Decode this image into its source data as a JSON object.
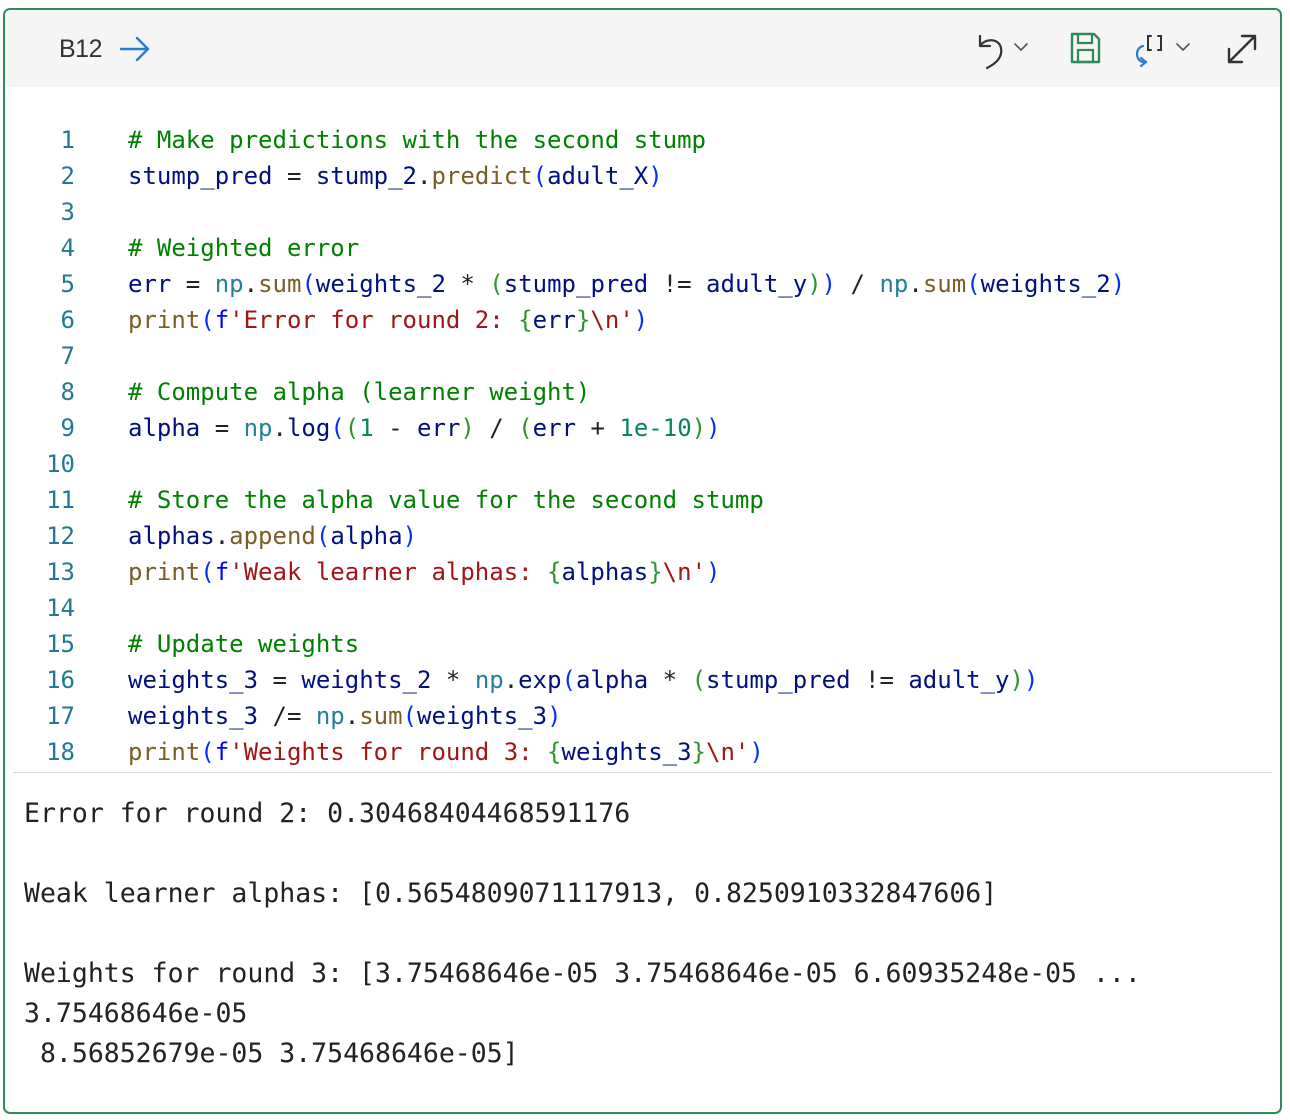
{
  "toolbar": {
    "cell_reference": "B12",
    "icons": [
      "arrow-right-icon",
      "undo-icon",
      "chevron-down-icon",
      "save-icon",
      "python-output-icon",
      "chevron-down-icon",
      "expand-icon"
    ]
  },
  "colors": {
    "border": "#2e8a5a",
    "comment": "#008000",
    "function": "#795e26",
    "string": "#a31515",
    "variable": "#001080",
    "number": "#098658",
    "line_number": "#237893"
  },
  "code_lines": [
    {
      "n": "1",
      "tokens": [
        {
          "t": "# Make predictions with the second stump",
          "c": "comment"
        }
      ]
    },
    {
      "n": "2",
      "tokens": [
        {
          "t": "stump_pred",
          "c": "var"
        },
        {
          "t": " = ",
          "c": "op"
        },
        {
          "t": "stump_2",
          "c": "var"
        },
        {
          "t": ".",
          "c": "op"
        },
        {
          "t": "predict",
          "c": "func"
        },
        {
          "t": "(",
          "c": "paren"
        },
        {
          "t": "adult_X",
          "c": "var"
        },
        {
          "t": ")",
          "c": "paren"
        }
      ]
    },
    {
      "n": "3",
      "tokens": []
    },
    {
      "n": "4",
      "tokens": [
        {
          "t": "# Weighted error",
          "c": "comment"
        }
      ]
    },
    {
      "n": "5",
      "tokens": [
        {
          "t": "err",
          "c": "var"
        },
        {
          "t": " = ",
          "c": "op"
        },
        {
          "t": "np",
          "c": "mod"
        },
        {
          "t": ".",
          "c": "op"
        },
        {
          "t": "sum",
          "c": "func"
        },
        {
          "t": "(",
          "c": "paren"
        },
        {
          "t": "weights_2",
          "c": "var"
        },
        {
          "t": " * ",
          "c": "op"
        },
        {
          "t": "(",
          "c": "paren2"
        },
        {
          "t": "stump_pred",
          "c": "var"
        },
        {
          "t": " != ",
          "c": "op"
        },
        {
          "t": "adult_y",
          "c": "var"
        },
        {
          "t": ")",
          "c": "paren2"
        },
        {
          "t": ")",
          "c": "paren"
        },
        {
          "t": " / ",
          "c": "op"
        },
        {
          "t": "np",
          "c": "mod"
        },
        {
          "t": ".",
          "c": "op"
        },
        {
          "t": "sum",
          "c": "func"
        },
        {
          "t": "(",
          "c": "paren"
        },
        {
          "t": "weights_2",
          "c": "var"
        },
        {
          "t": ")",
          "c": "paren"
        }
      ]
    },
    {
      "n": "6",
      "tokens": [
        {
          "t": "print",
          "c": "func"
        },
        {
          "t": "(",
          "c": "paren"
        },
        {
          "t": "f",
          "c": "kw"
        },
        {
          "t": "'Error for round 2: ",
          "c": "str"
        },
        {
          "t": "{",
          "c": "brace"
        },
        {
          "t": "err",
          "c": "var"
        },
        {
          "t": "}",
          "c": "brace"
        },
        {
          "t": "\\n",
          "c": "str"
        },
        {
          "t": "'",
          "c": "str"
        },
        {
          "t": ")",
          "c": "paren"
        }
      ]
    },
    {
      "n": "7",
      "tokens": []
    },
    {
      "n": "8",
      "tokens": [
        {
          "t": "# Compute alpha (learner weight)",
          "c": "comment"
        }
      ]
    },
    {
      "n": "9",
      "tokens": [
        {
          "t": "alpha",
          "c": "var"
        },
        {
          "t": " = ",
          "c": "op"
        },
        {
          "t": "np",
          "c": "mod"
        },
        {
          "t": ".",
          "c": "op"
        },
        {
          "t": "log",
          "c": "var"
        },
        {
          "t": "(",
          "c": "paren"
        },
        {
          "t": "(",
          "c": "paren2"
        },
        {
          "t": "1",
          "c": "num"
        },
        {
          "t": " - ",
          "c": "op"
        },
        {
          "t": "err",
          "c": "var"
        },
        {
          "t": ")",
          "c": "paren2"
        },
        {
          "t": " / ",
          "c": "op"
        },
        {
          "t": "(",
          "c": "paren2"
        },
        {
          "t": "err",
          "c": "var"
        },
        {
          "t": " + ",
          "c": "op"
        },
        {
          "t": "1e-10",
          "c": "num"
        },
        {
          "t": ")",
          "c": "paren2"
        },
        {
          "t": ")",
          "c": "paren"
        }
      ]
    },
    {
      "n": "10",
      "tokens": []
    },
    {
      "n": "11",
      "tokens": [
        {
          "t": "# Store the alpha value for the second stump",
          "c": "comment"
        }
      ]
    },
    {
      "n": "12",
      "tokens": [
        {
          "t": "alphas",
          "c": "var"
        },
        {
          "t": ".",
          "c": "op"
        },
        {
          "t": "append",
          "c": "func"
        },
        {
          "t": "(",
          "c": "paren"
        },
        {
          "t": "alpha",
          "c": "var"
        },
        {
          "t": ")",
          "c": "paren"
        }
      ]
    },
    {
      "n": "13",
      "tokens": [
        {
          "t": "print",
          "c": "func"
        },
        {
          "t": "(",
          "c": "paren"
        },
        {
          "t": "f",
          "c": "kw"
        },
        {
          "t": "'Weak learner alphas: ",
          "c": "str"
        },
        {
          "t": "{",
          "c": "brace"
        },
        {
          "t": "alphas",
          "c": "var"
        },
        {
          "t": "}",
          "c": "brace"
        },
        {
          "t": "\\n",
          "c": "str"
        },
        {
          "t": "'",
          "c": "str"
        },
        {
          "t": ")",
          "c": "paren"
        }
      ]
    },
    {
      "n": "14",
      "tokens": []
    },
    {
      "n": "15",
      "tokens": [
        {
          "t": "# Update weights",
          "c": "comment"
        }
      ]
    },
    {
      "n": "16",
      "tokens": [
        {
          "t": "weights_3",
          "c": "var"
        },
        {
          "t": " = ",
          "c": "op"
        },
        {
          "t": "weights_2",
          "c": "var"
        },
        {
          "t": " * ",
          "c": "op"
        },
        {
          "t": "np",
          "c": "mod"
        },
        {
          "t": ".",
          "c": "op"
        },
        {
          "t": "exp",
          "c": "var"
        },
        {
          "t": "(",
          "c": "paren"
        },
        {
          "t": "alpha",
          "c": "var"
        },
        {
          "t": " * ",
          "c": "op"
        },
        {
          "t": "(",
          "c": "paren2"
        },
        {
          "t": "stump_pred",
          "c": "var"
        },
        {
          "t": " != ",
          "c": "op"
        },
        {
          "t": "adult_y",
          "c": "var"
        },
        {
          "t": ")",
          "c": "paren2"
        },
        {
          "t": ")",
          "c": "paren"
        }
      ]
    },
    {
      "n": "17",
      "tokens": [
        {
          "t": "weights_3",
          "c": "var"
        },
        {
          "t": " /= ",
          "c": "op"
        },
        {
          "t": "np",
          "c": "mod"
        },
        {
          "t": ".",
          "c": "op"
        },
        {
          "t": "sum",
          "c": "func"
        },
        {
          "t": "(",
          "c": "paren"
        },
        {
          "t": "weights_3",
          "c": "var"
        },
        {
          "t": ")",
          "c": "paren"
        }
      ]
    },
    {
      "n": "18",
      "tokens": [
        {
          "t": "print",
          "c": "func"
        },
        {
          "t": "(",
          "c": "paren"
        },
        {
          "t": "f",
          "c": "kw"
        },
        {
          "t": "'Weights for round 3: ",
          "c": "str"
        },
        {
          "t": "{",
          "c": "brace"
        },
        {
          "t": "weights_3",
          "c": "var"
        },
        {
          "t": "}",
          "c": "brace"
        },
        {
          "t": "\\n",
          "c": "str"
        },
        {
          "t": "'",
          "c": "str"
        },
        {
          "t": ")",
          "c": "paren"
        }
      ]
    }
  ],
  "output_lines": [
    "Error for round 2: 0.30468404468591176",
    "",
    "Weak learner alphas: [0.5654809071117913, 0.8250910332847606]",
    "",
    "Weights for round 3: [3.75468646e-05 3.75468646e-05 6.60935248e-05 ...",
    "3.75468646e-05",
    " 8.56852679e-05 3.75468646e-05]"
  ]
}
